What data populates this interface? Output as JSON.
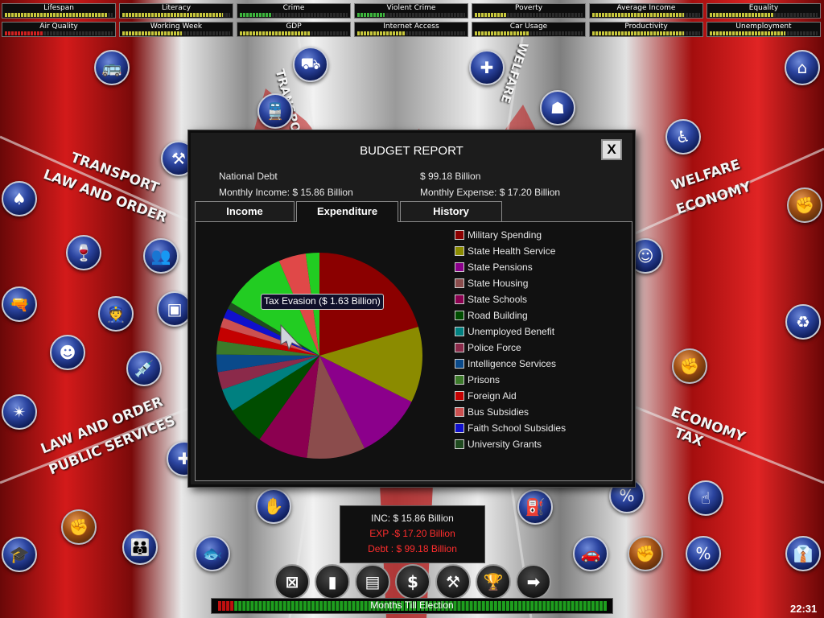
{
  "stats": [
    {
      "label": "Lifespan",
      "value": 0.95,
      "color": "#c8c83c"
    },
    {
      "label": "Literacy",
      "value": 0.93,
      "color": "#c8c83c"
    },
    {
      "label": "Crime",
      "value": 0.3,
      "color": "#3cb43c"
    },
    {
      "label": "Violent Crime",
      "value": 0.25,
      "color": "#3cb43c"
    },
    {
      "label": "Poverty",
      "value": 0.3,
      "color": "#c8c83c"
    },
    {
      "label": "Average Income",
      "value": 0.85,
      "color": "#c8c83c"
    },
    {
      "label": "Equality",
      "value": 0.6,
      "color": "#c8c83c"
    },
    {
      "label": "Air Quality",
      "value": 0.35,
      "color": "#d02020"
    },
    {
      "label": "Working Week",
      "value": 0.55,
      "color": "#c8c83c"
    },
    {
      "label": "GDP",
      "value": 0.65,
      "color": "#c8c83c"
    },
    {
      "label": "Internet Access",
      "value": 0.45,
      "color": "#c8c83c"
    },
    {
      "label": "Car Usage",
      "value": 0.5,
      "color": "#c8c83c"
    },
    {
      "label": "Productivity",
      "value": 0.85,
      "color": "#c8c83c"
    },
    {
      "label": "Unemployment",
      "value": 0.7,
      "color": "#c8c83c"
    }
  ],
  "background_labels": [
    {
      "text": "TRANSPORT"
    },
    {
      "text": "LAW AND ORDER"
    },
    {
      "text": "WELFARE"
    },
    {
      "text": "ECONOMY"
    },
    {
      "text": "LAW AND ORDER"
    },
    {
      "text": "PUBLIC SERVICES"
    },
    {
      "text": "ECONOMY"
    },
    {
      "text": "TAX"
    },
    {
      "text": "TRANSPORT"
    },
    {
      "text": "WELFARE"
    }
  ],
  "policy_icons": [
    {
      "name": "bus-icon",
      "glyph": "🚌"
    },
    {
      "name": "tank-icon",
      "glyph": "⛟"
    },
    {
      "name": "hospital-ship-icon",
      "glyph": "✚"
    },
    {
      "name": "elderly-icon",
      "glyph": "☗"
    },
    {
      "name": "houses-icon",
      "glyph": "⌂"
    },
    {
      "name": "rail-icon",
      "glyph": "🚆"
    },
    {
      "name": "disabled-care-icon",
      "glyph": "♿"
    },
    {
      "name": "road-works-icon",
      "glyph": "⚒"
    },
    {
      "name": "casino-icon",
      "glyph": "♠"
    },
    {
      "name": "alcohol-icon",
      "glyph": "🍷"
    },
    {
      "name": "crowd-icon",
      "glyph": "👥"
    },
    {
      "name": "gun-icon",
      "glyph": "🔫"
    },
    {
      "name": "police-officer-icon",
      "glyph": "👮"
    },
    {
      "name": "id-card-icon",
      "glyph": "▣"
    },
    {
      "name": "syringe-icon",
      "glyph": "💉"
    },
    {
      "name": "prisoner-icon",
      "glyph": "☻"
    },
    {
      "name": "alarm-icon",
      "glyph": "✴"
    },
    {
      "name": "mother-child-icon",
      "glyph": "☺"
    },
    {
      "name": "recycling-icon",
      "glyph": "♻"
    },
    {
      "name": "first-aid-icon",
      "glyph": "✚"
    },
    {
      "name": "religion-icon",
      "glyph": "✋"
    },
    {
      "name": "fuel-pump-icon",
      "glyph": "⛽"
    },
    {
      "name": "percent-tax-icon",
      "glyph": "%"
    },
    {
      "name": "hand-touch-icon",
      "glyph": "☝"
    },
    {
      "name": "education-grant-icon",
      "glyph": "🎓"
    },
    {
      "name": "schoolchildren-icon",
      "glyph": "👪"
    },
    {
      "name": "fish-icon",
      "glyph": "🐟"
    },
    {
      "name": "car-icon",
      "glyph": "🚗"
    },
    {
      "name": "sales-tax-icon",
      "glyph": "%"
    },
    {
      "name": "businessman-icon",
      "glyph": "👔"
    }
  ],
  "bronze_icons": [
    {
      "name": "pressure-group-icon-1",
      "glyph": "✊"
    },
    {
      "name": "pressure-group-icon-2",
      "glyph": "✊"
    },
    {
      "name": "pressure-group-icon-3",
      "glyph": "✊"
    },
    {
      "name": "pressure-group-icon-4",
      "glyph": "✊"
    }
  ],
  "budget": {
    "title": "BUDGET REPORT",
    "close_label": "X",
    "national_debt_label": "National Debt",
    "national_debt_value": "$ 99.18 Billion",
    "monthly_income": "Monthly Income: $ 15.86 Billion",
    "monthly_expense": "Monthly Expense: $ 17.20 Billion",
    "tabs": [
      {
        "label": "Income",
        "active": false
      },
      {
        "label": "Expenditure",
        "active": true
      },
      {
        "label": "History",
        "active": false
      }
    ],
    "tooltip": "Tax Evasion ($ 1.63 Billion)"
  },
  "chart_data": {
    "type": "pie",
    "title": "",
    "slices": [
      {
        "label": "Military Spending",
        "value": 3.35,
        "color": "#8b0000"
      },
      {
        "label": "State Health Service",
        "value": 1.95,
        "color": "#8b8b00"
      },
      {
        "label": "State Pensions",
        "value": 1.7,
        "color": "#8b008b"
      },
      {
        "label": "State Housing",
        "value": 1.5,
        "color": "#8b4c4c"
      },
      {
        "label": "State Schools",
        "value": 1.3,
        "color": "#8b0050"
      },
      {
        "label": "Road Building",
        "value": 1.0,
        "color": "#004d00"
      },
      {
        "label": "Unemployed Benefit",
        "value": 0.6,
        "color": "#008080"
      },
      {
        "label": "Police Force",
        "value": 0.45,
        "color": "#8b2a4a"
      },
      {
        "label": "Intelligence Services",
        "value": 0.45,
        "color": "#0a4a8b"
      },
      {
        "label": "Prisons",
        "value": 0.35,
        "color": "#3c7a2a"
      },
      {
        "label": "Foreign Aid",
        "value": 0.35,
        "color": "#c40000"
      },
      {
        "label": "Bus Subsidies",
        "value": 0.25,
        "color": "#cc5050"
      },
      {
        "label": "Faith School Subsidies",
        "value": 0.25,
        "color": "#1010cc"
      },
      {
        "label": "University Grants",
        "value": 0.18,
        "color": "#1f4a1f"
      },
      {
        "label": "Tax Evasion",
        "value": 1.63,
        "color": "#22cc22"
      },
      {
        "label": "",
        "value": 0.7,
        "color": "#e04848"
      },
      {
        "label": "",
        "value": 0.35,
        "color": "#22cc22"
      }
    ]
  },
  "summary": {
    "inc": "INC: $ 15.86 Billion",
    "exp": "EXP -$ 17.20 Billion",
    "debt": "Debt : $ 99.18 Billion"
  },
  "toolbar": [
    {
      "name": "cabinet-icon",
      "glyph": "⊠"
    },
    {
      "name": "statistics-icon",
      "glyph": "▮"
    },
    {
      "name": "policies-document-icon",
      "glyph": "▤"
    },
    {
      "name": "budget-dollar-icon",
      "glyph": "$"
    },
    {
      "name": "tools-icon",
      "glyph": "⚒"
    },
    {
      "name": "trophy-icon",
      "glyph": "🏆"
    },
    {
      "name": "next-turn-arrow-icon",
      "glyph": "➡"
    }
  ],
  "election": {
    "label": "Months Till Election",
    "elapsed_fraction": 0.04,
    "elapsed_color": "#c01010",
    "remaining_color": "#1e9e1e"
  },
  "clock": "22:31"
}
